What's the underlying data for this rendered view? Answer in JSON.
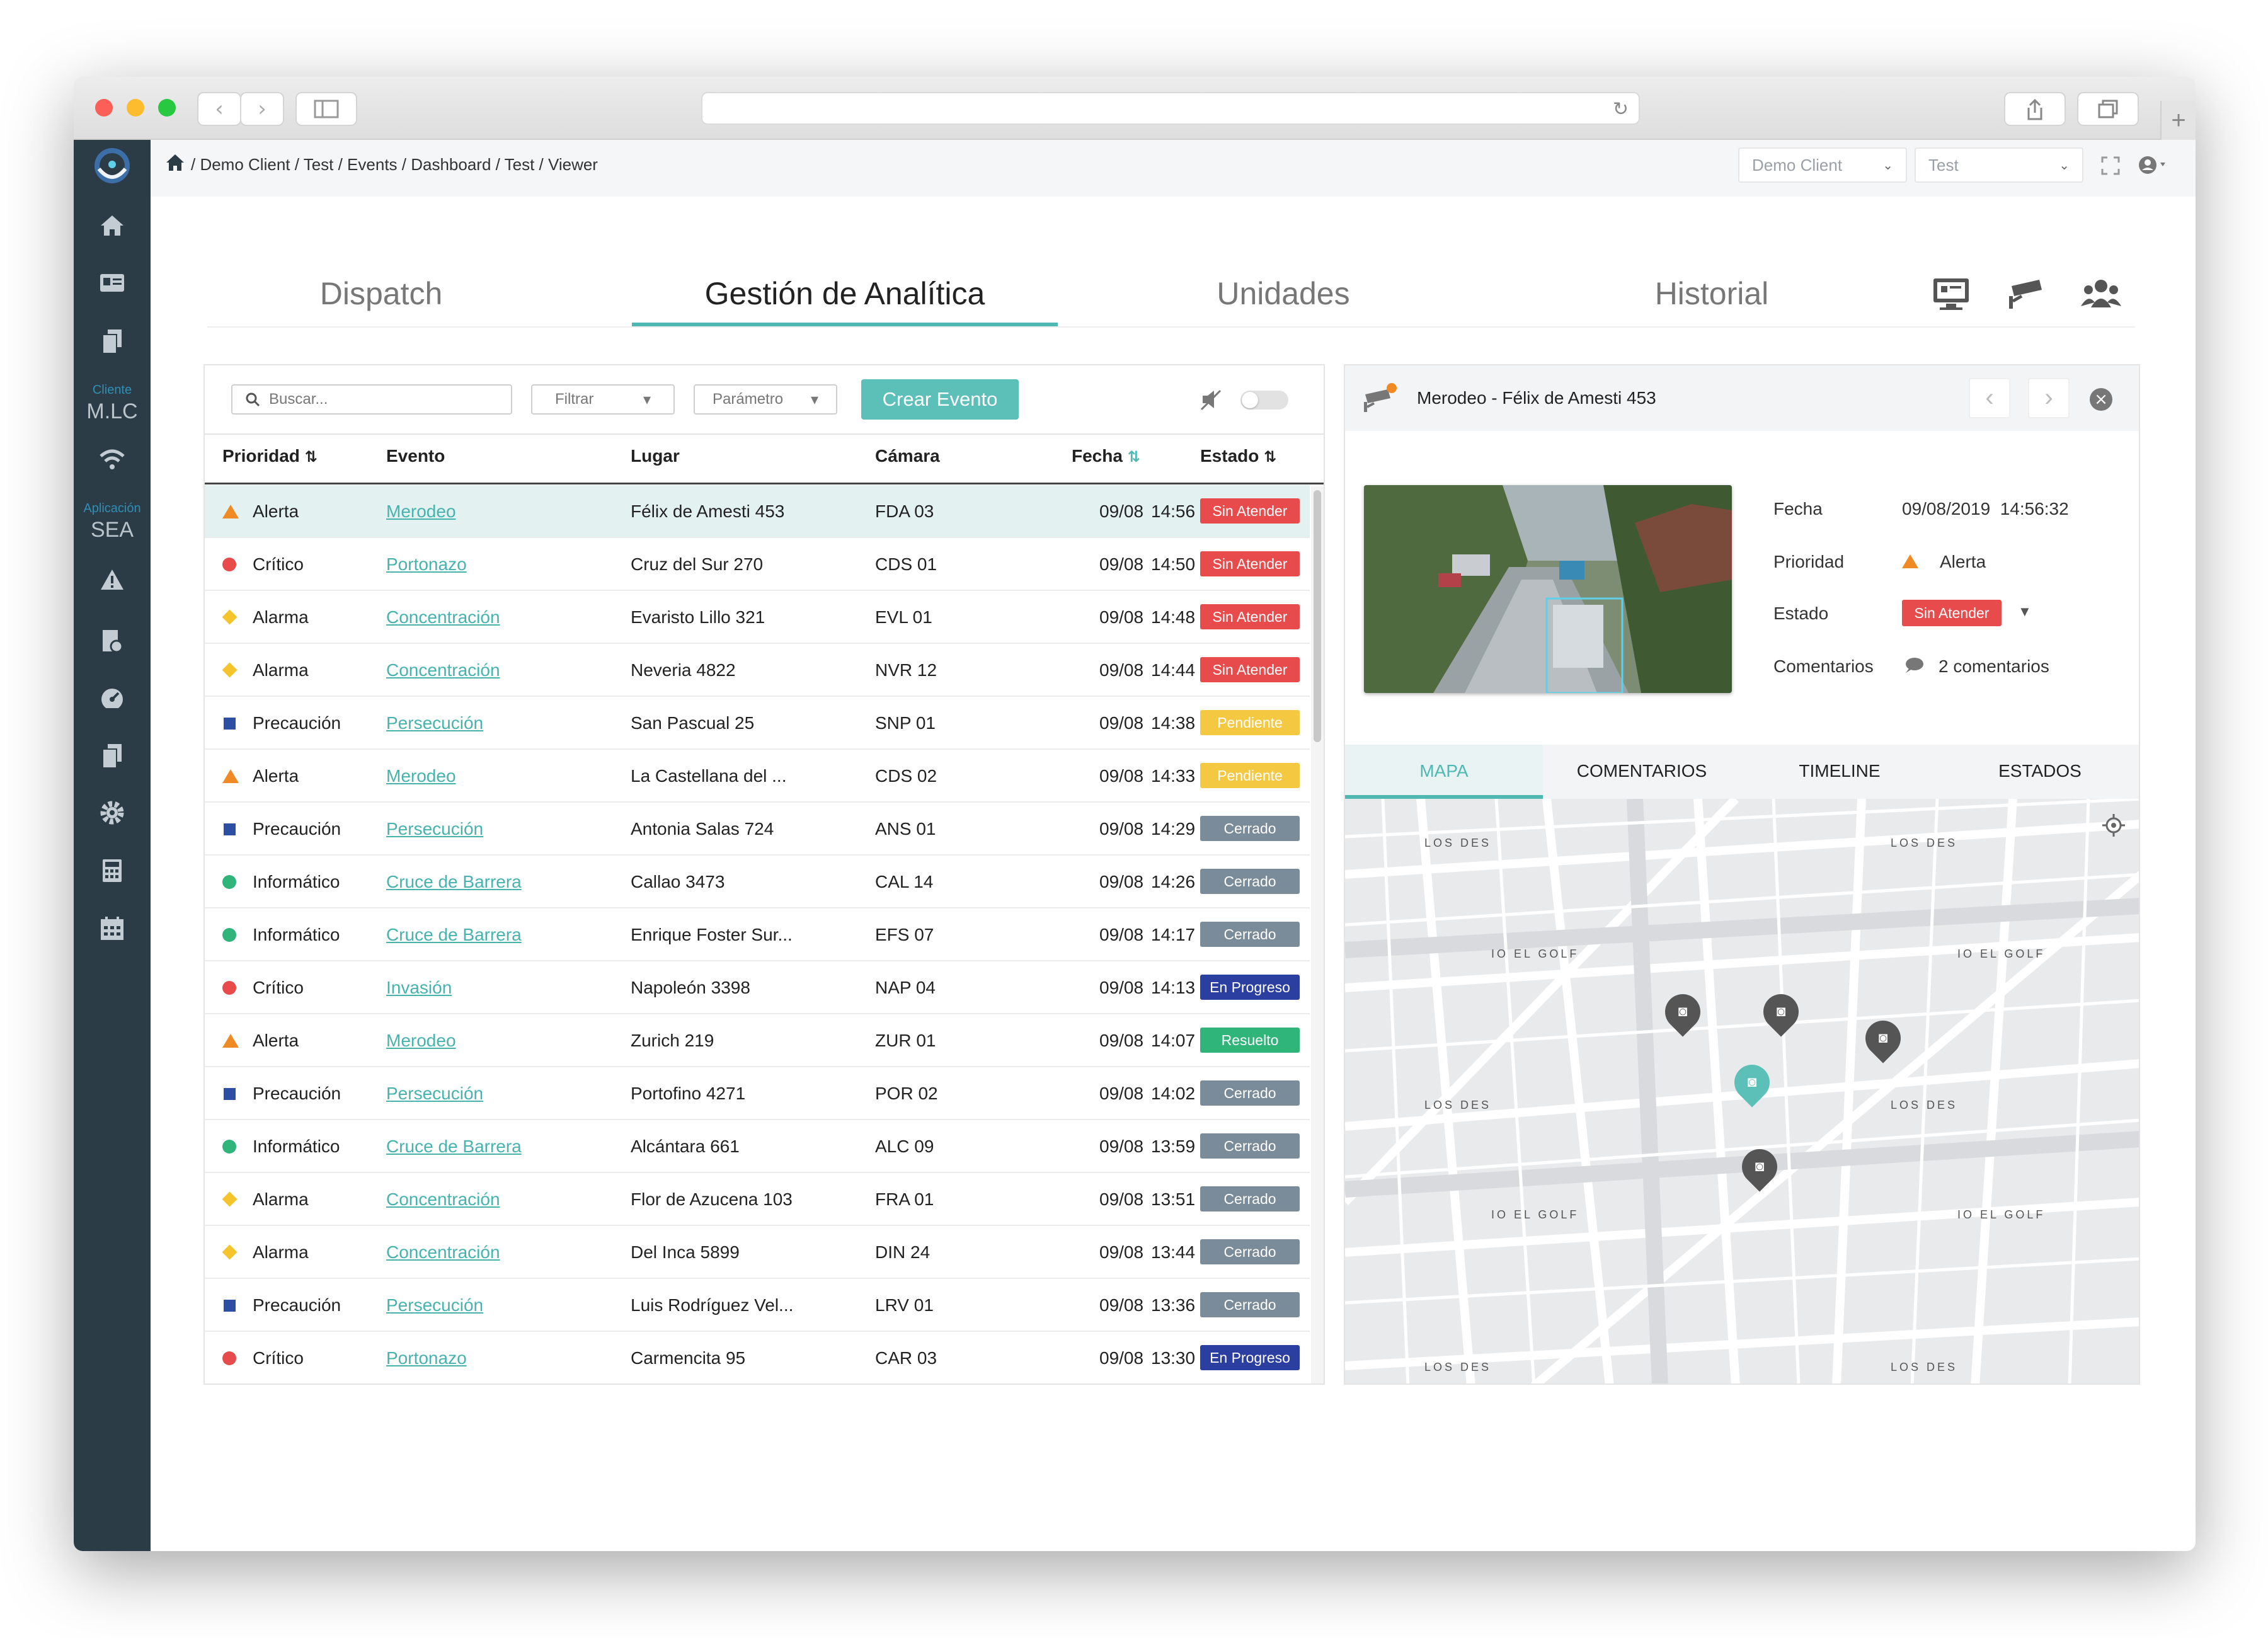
{
  "breadcrumb": "/ Demo Client / Test / Events / Dashboard / Test / Viewer",
  "header": {
    "client_select": "Demo Client",
    "project_select": "Test"
  },
  "sidebar": {
    "cliente_label": "Cliente",
    "cliente_value": "M.LC",
    "aplicacion_label": "Aplicación",
    "aplicacion_value": "SEA"
  },
  "tabs": [
    {
      "label": "Dispatch"
    },
    {
      "label": "Gestión de Analítica"
    },
    {
      "label": "Unidades"
    },
    {
      "label": "Historial"
    }
  ],
  "toolbar": {
    "search_placeholder": "Buscar...",
    "filter_label": "Filtrar",
    "param_label": "Parámetro",
    "create_label": "Crear Evento"
  },
  "table": {
    "headers": [
      "Prioridad",
      "Evento",
      "Lugar",
      "Cámara",
      "Fecha",
      "Estado"
    ],
    "rows": [
      {
        "prioridad": "Alerta",
        "evento": "Merodeo",
        "lugar": "Félix de Amesti 453",
        "camara": "FDA 03",
        "fecha": "09/08",
        "hora": "14:56",
        "estado": "Sin Atender"
      },
      {
        "prioridad": "Crítico",
        "evento": "Portonazo",
        "lugar": "Cruz del Sur 270",
        "camara": "CDS 01",
        "fecha": "09/08",
        "hora": "14:50",
        "estado": "Sin Atender"
      },
      {
        "prioridad": "Alarma",
        "evento": "Concentración",
        "lugar": "Evaristo Lillo 321",
        "camara": "EVL 01",
        "fecha": "09/08",
        "hora": "14:48",
        "estado": "Sin Atender"
      },
      {
        "prioridad": "Alarma",
        "evento": "Concentración",
        "lugar": "Neveria 4822",
        "camara": "NVR 12",
        "fecha": "09/08",
        "hora": "14:44",
        "estado": "Sin Atender"
      },
      {
        "prioridad": "Precaución",
        "evento": "Persecución",
        "lugar": "San Pascual 25",
        "camara": "SNP 01",
        "fecha": "09/08",
        "hora": "14:38",
        "estado": "Pendiente"
      },
      {
        "prioridad": "Alerta",
        "evento": "Merodeo",
        "lugar": "La Castellana del ...",
        "camara": "CDS 02",
        "fecha": "09/08",
        "hora": "14:33",
        "estado": "Pendiente"
      },
      {
        "prioridad": "Precaución",
        "evento": "Persecución",
        "lugar": "Antonia Salas 724",
        "camara": "ANS 01",
        "fecha": "09/08",
        "hora": "14:29",
        "estado": "Cerrado"
      },
      {
        "prioridad": "Informático",
        "evento": "Cruce de Barrera",
        "lugar": "Callao 3473",
        "camara": "CAL 14",
        "fecha": "09/08",
        "hora": "14:26",
        "estado": "Cerrado"
      },
      {
        "prioridad": "Informático",
        "evento": "Cruce de Barrera",
        "lugar": "Enrique Foster Sur...",
        "camara": "EFS 07",
        "fecha": "09/08",
        "hora": "14:17",
        "estado": "Cerrado"
      },
      {
        "prioridad": "Crítico",
        "evento": "Invasión",
        "lugar": "Napoleón 3398",
        "camara": "NAP 04",
        "fecha": "09/08",
        "hora": "14:13",
        "estado": "En Progreso"
      },
      {
        "prioridad": "Alerta",
        "evento": "Merodeo",
        "lugar": "Zurich 219",
        "camara": "ZUR 01",
        "fecha": "09/08",
        "hora": "14:07",
        "estado": "Resuelto"
      },
      {
        "prioridad": "Precaución",
        "evento": "Persecución",
        "lugar": "Portofino 4271",
        "camara": "POR 02",
        "fecha": "09/08",
        "hora": "14:02",
        "estado": "Cerrado"
      },
      {
        "prioridad": "Informático",
        "evento": "Cruce de Barrera",
        "lugar": "Alcántara 661",
        "camara": "ALC 09",
        "fecha": "09/08",
        "hora": "13:59",
        "estado": "Cerrado"
      },
      {
        "prioridad": "Alarma",
        "evento": "Concentración",
        "lugar": "Flor de Azucena 103",
        "camara": "FRA 01",
        "fecha": "09/08",
        "hora": "13:51",
        "estado": "Cerrado"
      },
      {
        "prioridad": "Alarma",
        "evento": "Concentración",
        "lugar": "Del Inca 5899",
        "camara": "DIN 24",
        "fecha": "09/08",
        "hora": "13:44",
        "estado": "Cerrado"
      },
      {
        "prioridad": "Precaución",
        "evento": "Persecución",
        "lugar": "Luis Rodríguez Vel...",
        "camara": "LRV 01",
        "fecha": "09/08",
        "hora": "13:36",
        "estado": "Cerrado"
      },
      {
        "prioridad": "Crítico",
        "evento": "Portonazo",
        "lugar": "Carmencita 95",
        "camara": "CAR 03",
        "fecha": "09/08",
        "hora": "13:30",
        "estado": "En Progreso"
      }
    ]
  },
  "priority_colors": {
    "Alerta": "#f08a24",
    "Crítico": "#e84b4b",
    "Alarma": "#f5c42c",
    "Precaución": "#2c4fa3",
    "Informático": "#2fb57a"
  },
  "status_colors": {
    "Sin Atender": "#e84b4b",
    "Pendiente": "#f5c842",
    "Cerrado": "#7a8c99",
    "En Progreso": "#2b3fa0",
    "Resuelto": "#2fb57a"
  },
  "detail": {
    "title": "Merodeo - Félix de Amesti 453",
    "fecha_label": "Fecha",
    "fecha_value": "09/08/2019  14:56:32",
    "prioridad_label": "Prioridad",
    "prioridad_value": "Alerta",
    "estado_label": "Estado",
    "estado_value": "Sin Atender",
    "comentarios_label": "Comentarios",
    "comentarios_value": "2 comentarios",
    "tabs": [
      "MAPA",
      "COMENTARIOS",
      "TIMELINE",
      "ESTADOS"
    ]
  },
  "map": {
    "labels": [
      "LOS DES",
      "LOS DES",
      "IO EL GOLF",
      "IO EL GOLF",
      "LOS DES",
      "LOS DES",
      "IO EL GOLF",
      "IO EL GOLF",
      "LOS DES",
      "LOS DES"
    ]
  }
}
